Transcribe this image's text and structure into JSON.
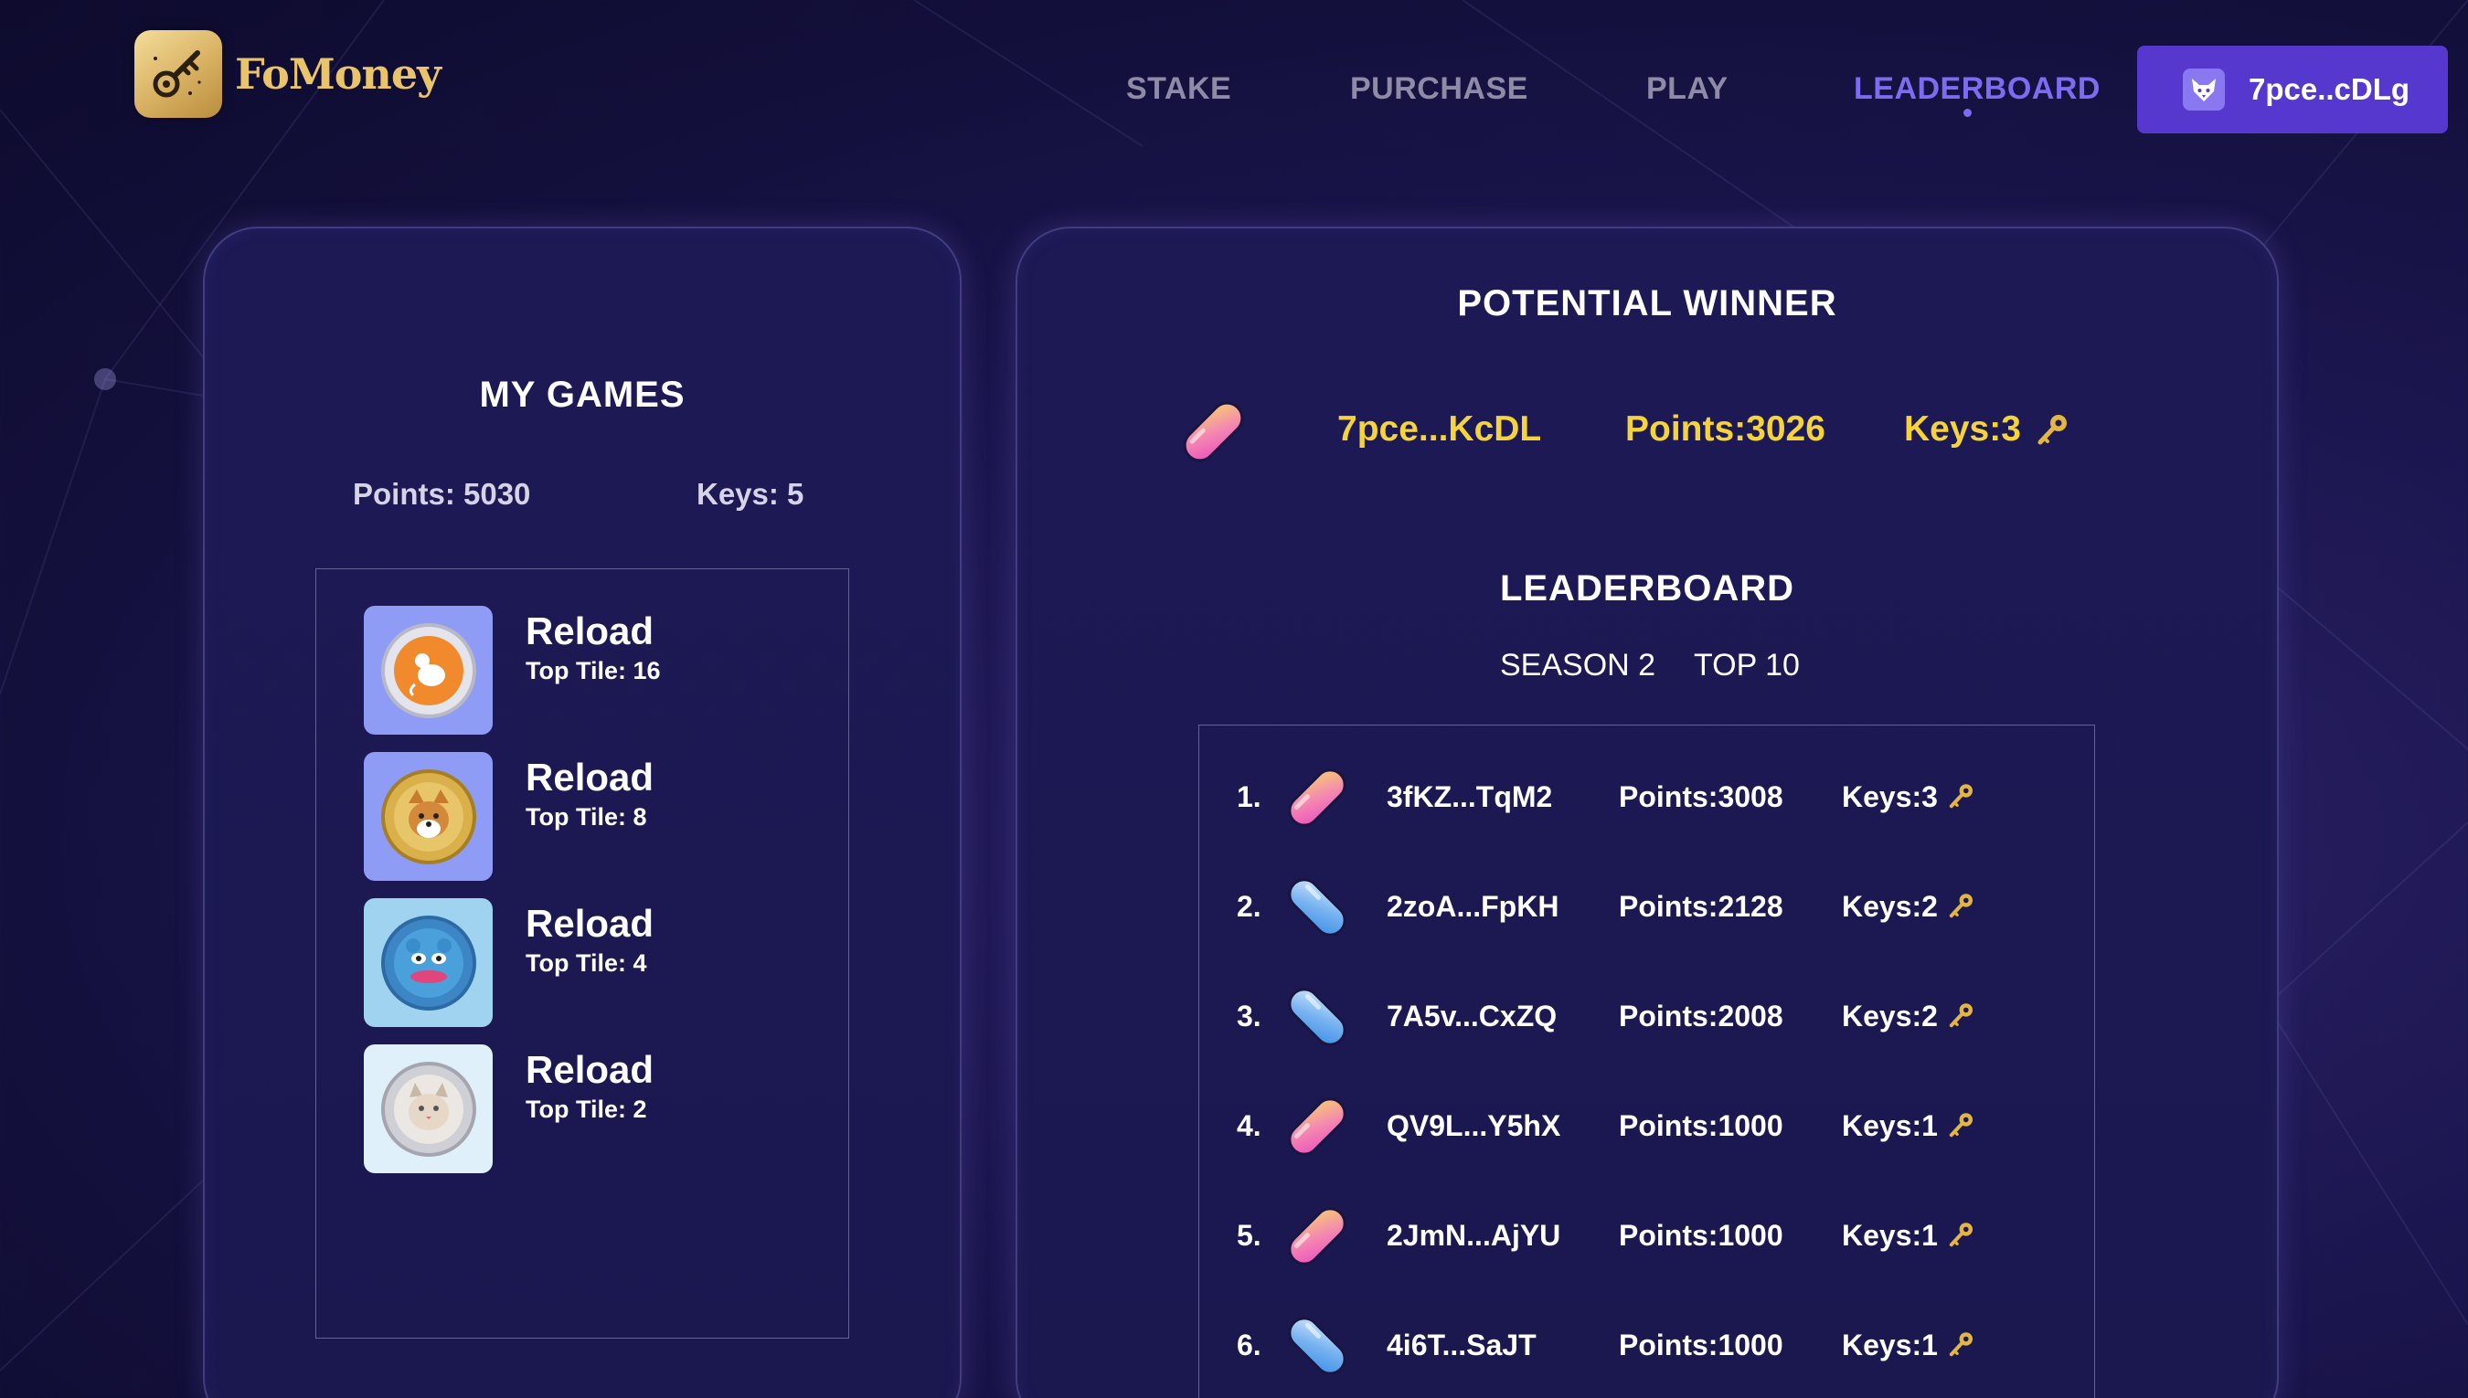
{
  "brand": {
    "name": "FoMoney",
    "logo_icon": "key-icon"
  },
  "nav": {
    "items": [
      "STAKE",
      "PURCHASE",
      "PLAY",
      "LEADERBOARD"
    ],
    "active": "LEADERBOARD"
  },
  "wallet": {
    "label": "7pce..cDLg",
    "icon": "fox-icon"
  },
  "my_games": {
    "title": "MY GAMES",
    "points_label": "Points: 5030",
    "keys_label": "Keys: 5",
    "games": [
      {
        "name": "Reload",
        "top_tile": "Top Tile: 16",
        "coin": "rat-coin-icon"
      },
      {
        "name": "Reload",
        "top_tile": "Top Tile: 8",
        "coin": "doge-coin-icon"
      },
      {
        "name": "Reload",
        "top_tile": "Top Tile: 4",
        "coin": "pepe-coin-icon"
      },
      {
        "name": "Reload",
        "top_tile": "Top Tile: 2",
        "coin": "cat-coin-icon"
      }
    ]
  },
  "potential_winner": {
    "title": "POTENTIAL WINNER",
    "address": "7pce...KcDL",
    "points": "Points:3026",
    "keys": "Keys:3"
  },
  "leaderboard": {
    "title": "LEADERBOARD",
    "season": "SEASON 2",
    "filter": "TOP 10",
    "rows": [
      {
        "rank": "1.",
        "address": "3fKZ...TqM2",
        "points": "Points:3008",
        "keys": "Keys:3",
        "pill": "pink"
      },
      {
        "rank": "2.",
        "address": "2zoA...FpKH",
        "points": "Points:2128",
        "keys": "Keys:2",
        "pill": "blue"
      },
      {
        "rank": "3.",
        "address": "7A5v...CxZQ",
        "points": "Points:2008",
        "keys": "Keys:2",
        "pill": "blue"
      },
      {
        "rank": "4.",
        "address": "QV9L...Y5hX",
        "points": "Points:1000",
        "keys": "Keys:1",
        "pill": "pink"
      },
      {
        "rank": "5.",
        "address": "2JmN...AjYU",
        "points": "Points:1000",
        "keys": "Keys:1",
        "pill": "pink"
      },
      {
        "rank": "6.",
        "address": "4i6T...SaJT",
        "points": "Points:1000",
        "keys": "Keys:1",
        "pill": "blue"
      }
    ]
  },
  "colors": {
    "accent": "#5738cf",
    "nav_active": "#7b6cf0",
    "highlight": "#f5d33a"
  }
}
